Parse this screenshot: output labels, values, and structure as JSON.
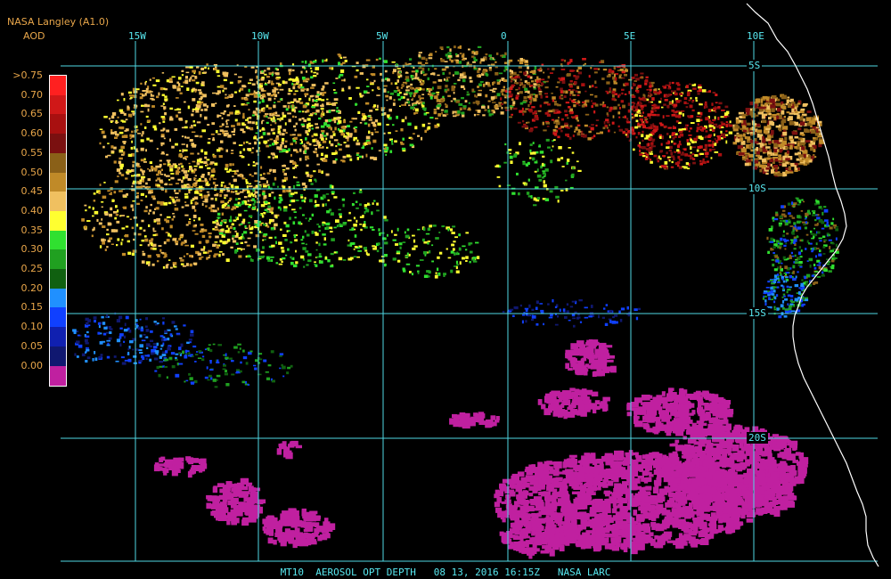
{
  "header": {
    "source": "NASA Langley (A1.0)",
    "product": "AOD"
  },
  "legend": [
    {
      "label": ">0.75",
      "color": "#ff2020"
    },
    {
      "label": "0.70",
      "color": "#d01818"
    },
    {
      "label": "0.65",
      "color": "#a81010"
    },
    {
      "label": "0.60",
      "color": "#7a1010"
    },
    {
      "label": "0.55",
      "color": "#8a6018"
    },
    {
      "label": "0.50",
      "color": "#c08a28"
    },
    {
      "label": "0.45",
      "color": "#f0c060"
    },
    {
      "label": "0.40",
      "color": "#ffff30"
    },
    {
      "label": "0.35",
      "color": "#30e030"
    },
    {
      "label": "0.30",
      "color": "#20a020"
    },
    {
      "label": "0.25",
      "color": "#106010"
    },
    {
      "label": "0.20",
      "color": "#2090ff"
    },
    {
      "label": "0.15",
      "color": "#1040ff"
    },
    {
      "label": "0.10",
      "color": "#1020b0"
    },
    {
      "label": "0.05",
      "color": "#101870"
    },
    {
      "label": "0.00",
      "color": "#c020a0"
    }
  ],
  "grid": {
    "lon_labels": [
      "15W",
      "10W",
      "5W",
      "0",
      "5E",
      "10E"
    ],
    "lat_labels": [
      "5S",
      "10S",
      "15S",
      "20S"
    ]
  },
  "footer": {
    "caption": "MT10  AEROSOL OPT DEPTH   08 13, 2016 16:15Z   NASA LARC"
  }
}
